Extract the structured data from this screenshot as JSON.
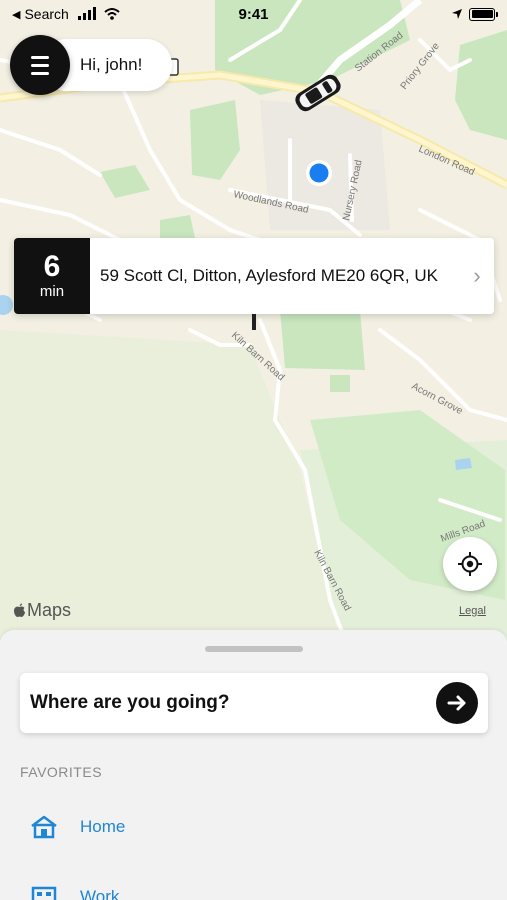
{
  "status_bar": {
    "back_label": "Search",
    "time": "9:41",
    "icons": [
      "back-arrow-icon",
      "signal-icon",
      "wifi-icon",
      "location-arrow-icon",
      "battery-icon"
    ]
  },
  "greeting": {
    "text": "Hi, john!",
    "menu_icon": "hamburger-menu-icon"
  },
  "map": {
    "streets": [
      "Station Road",
      "Priory Grove",
      "London Road",
      "Woodlands Road",
      "Nursery Road",
      "Kiln Barn Road",
      "Acorn Grove",
      "Mills Road",
      "Kiln Barn Road"
    ],
    "attribution": "Maps",
    "legal": "Legal"
  },
  "eta": {
    "minutes": "6",
    "unit": "min",
    "address": "59 Scott Cl, Ditton, Aylesford ME20 6QR, UK",
    "chevron": "›"
  },
  "locate_button": {
    "icon": "crosshair-locate-icon"
  },
  "sheet": {
    "search_label": "Where are you going?",
    "go_icon": "arrow-right-icon",
    "favorites_title": "FAVORITES",
    "favorites": [
      {
        "label": "Home",
        "icon": "home-icon"
      },
      {
        "label": "Work",
        "icon": "work-icon"
      }
    ]
  },
  "colors": {
    "accent": "#1f86d6",
    "dark": "#111111",
    "map_green": "#c9e6bf",
    "map_land": "#f3f0e3",
    "user_dot": "#1a7df0"
  }
}
